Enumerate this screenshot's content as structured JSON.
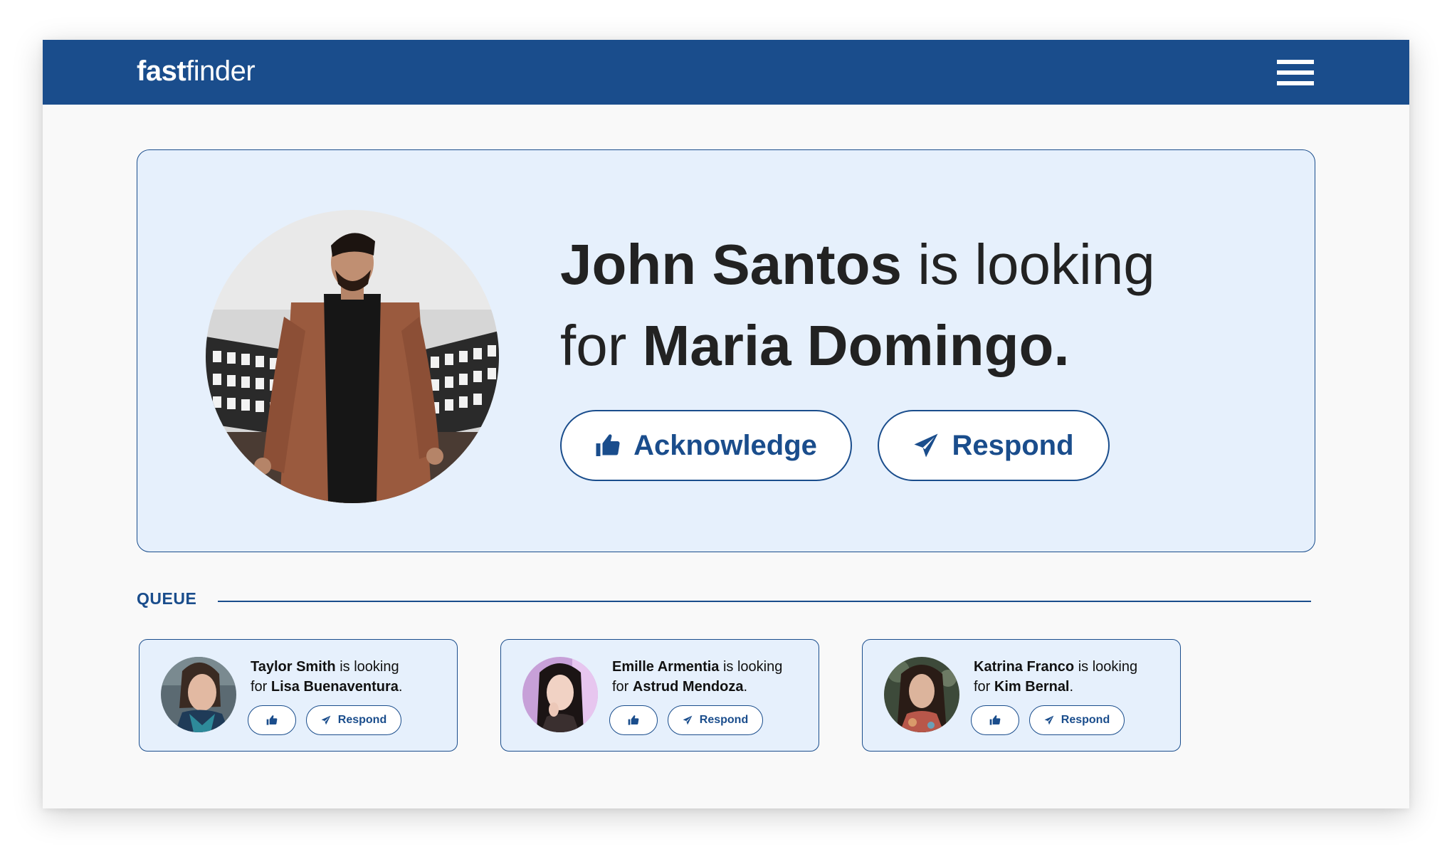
{
  "app": {
    "brand_bold": "fast",
    "brand_light": "finder"
  },
  "hero": {
    "requester": "John Santos",
    "phrase_looking": "is looking",
    "phrase_for": "for",
    "target": "Maria Domingo",
    "end": ".",
    "acknowledge_label": "Acknowledge",
    "respond_label": "Respond"
  },
  "queue": {
    "label": "QUEUE",
    "items": [
      {
        "requester": "Taylor Smith",
        "phrase_looking": "is looking",
        "phrase_for": "for",
        "target": "Lisa Buenaventura",
        "end": ".",
        "respond_label": "Respond"
      },
      {
        "requester": "Emille Armentia",
        "phrase_looking": "is looking",
        "phrase_for": "for",
        "target": "Astrud Mendoza",
        "end": ".",
        "respond_label": "Respond"
      },
      {
        "requester": "Katrina Franco",
        "phrase_looking": "is looking",
        "phrase_for": "for",
        "target": "Kim Bernal",
        "end": ".",
        "respond_label": "Respond"
      }
    ]
  },
  "icons": {
    "menu": "hamburger-menu-icon",
    "acknowledge": "thumbs-up-icon",
    "respond": "paper-plane-icon"
  },
  "colors": {
    "brand": "#1a4d8c",
    "panel": "#e6f0fc",
    "background": "#f9f9f9",
    "text": "#222222"
  }
}
